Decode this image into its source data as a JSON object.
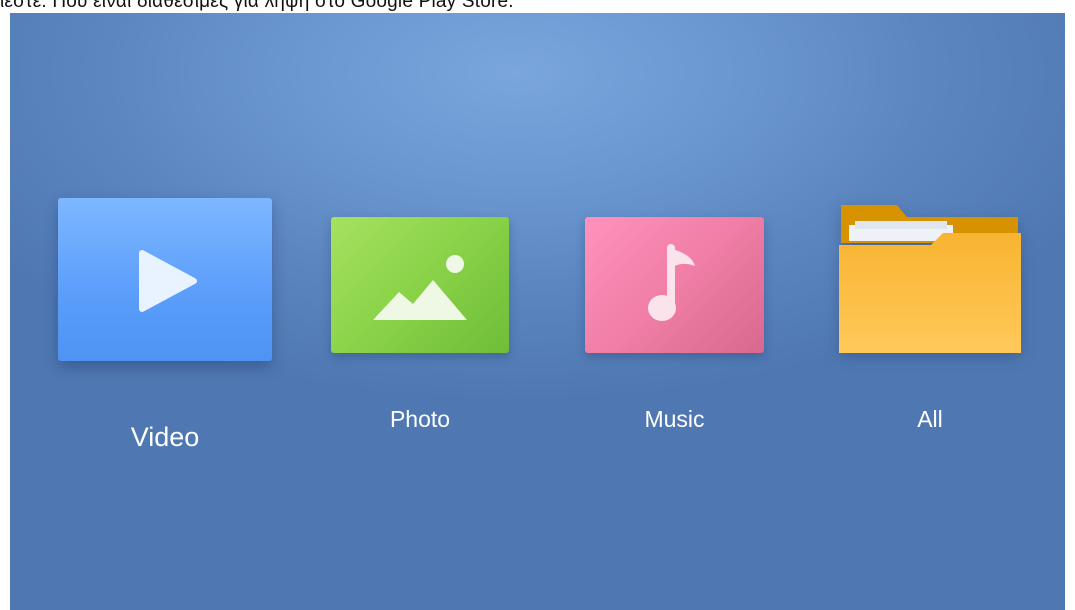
{
  "caption": {
    "text": "ίεστε. Που είναι διαθέσιμες για λήψη στο Google Play Store."
  },
  "launcher": {
    "tiles": [
      {
        "id": "video",
        "label": "Video",
        "icon": "play-icon",
        "color": "#5a9dfa",
        "focused": true
      },
      {
        "id": "photo",
        "label": "Photo",
        "icon": "image-icon",
        "color": "#8cd44a",
        "focused": false
      },
      {
        "id": "music",
        "label": "Music",
        "icon": "music-note-icon",
        "color": "#f07ea6",
        "focused": false
      },
      {
        "id": "all",
        "label": "All",
        "icon": "folder-icon",
        "color": "#f5b53a",
        "focused": false
      }
    ]
  }
}
